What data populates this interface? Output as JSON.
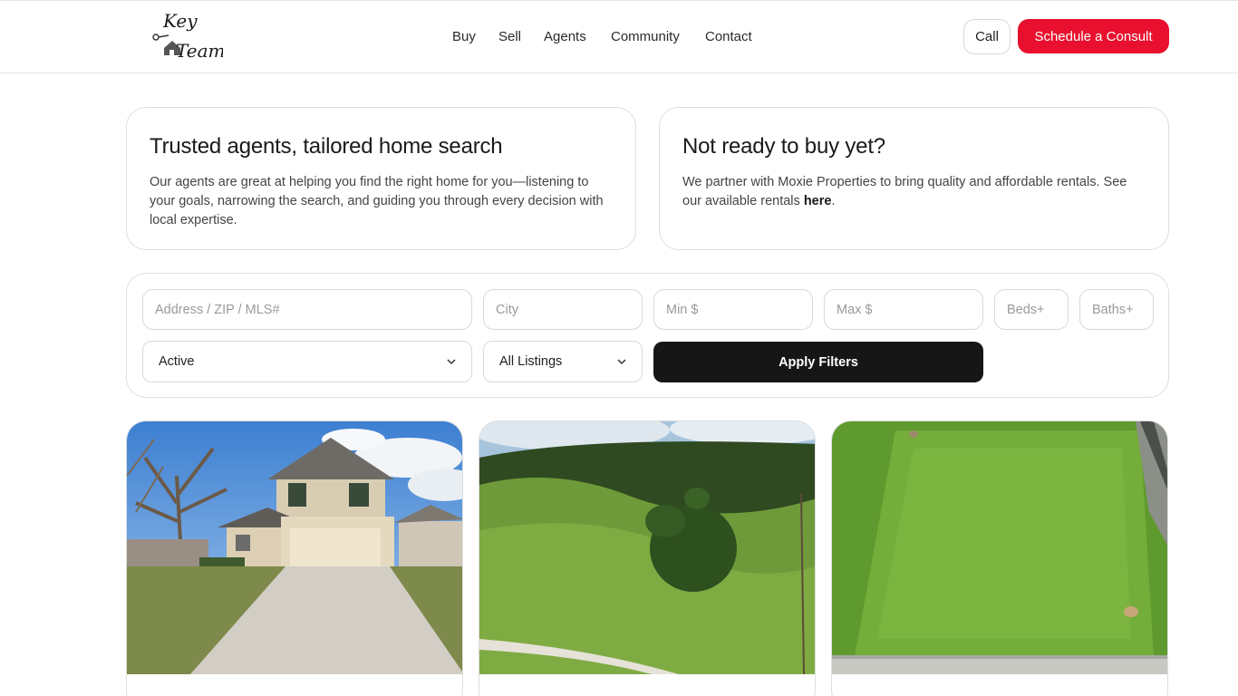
{
  "header": {
    "logo_text_top": "Key",
    "logo_text_bottom": "Team",
    "nav": [
      "Buy",
      "Sell",
      "Agents",
      "Community",
      "Contact"
    ],
    "call_label": "Call",
    "consult_label": "Schedule a Consult"
  },
  "info": {
    "left": {
      "title": "Trusted agents, tailored home search",
      "body": "Our agents are great at helping you find the right home for you—listening to your goals, narrowing the search, and guiding you through every decision with local expertise."
    },
    "right": {
      "title": "Not ready to buy yet?",
      "body_before": "We partner with Moxie Properties to bring quality and affordable rentals. See our available rentals ",
      "link": "here",
      "body_after": "."
    }
  },
  "filters": {
    "address_placeholder": "Address / ZIP / MLS#",
    "city_placeholder": "City",
    "min_placeholder": "Min $",
    "max_placeholder": "Max $",
    "beds_placeholder": "Beds+",
    "baths_placeholder": "Baths+",
    "status_value": "Active",
    "type_value": "All Listings",
    "apply_label": "Apply Filters"
  },
  "listings": [
    {
      "photo": "house-with-garage"
    },
    {
      "photo": "rolling-green-hills"
    },
    {
      "photo": "aerial-grass-lot"
    }
  ],
  "colors": {
    "accent": "#e8102e",
    "dark_button": "#161616"
  }
}
